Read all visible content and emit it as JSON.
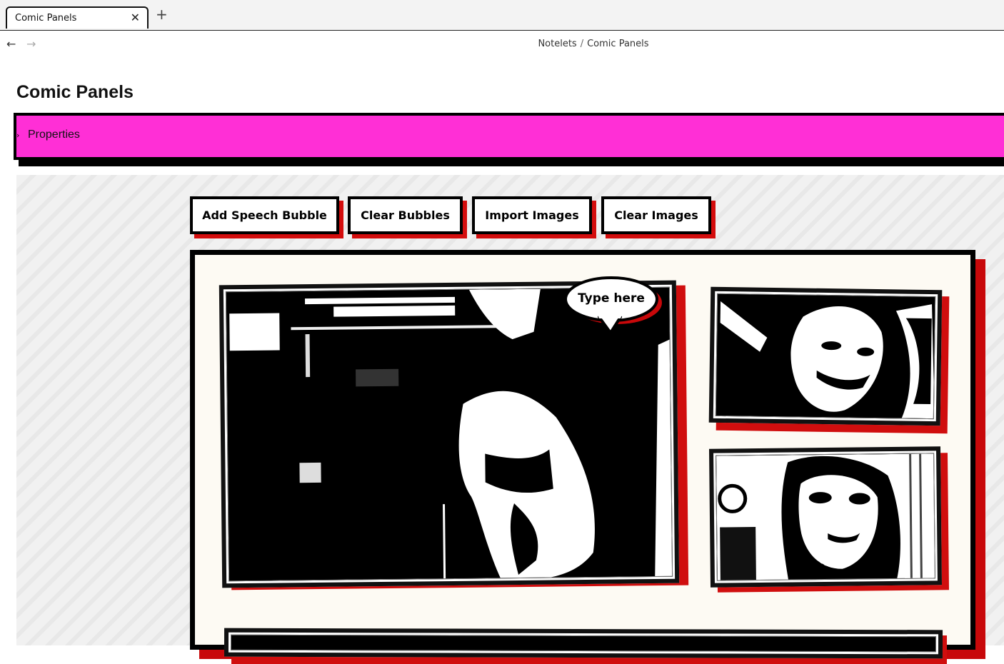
{
  "tab": {
    "title": "Comic Panels",
    "close_icon": "close-icon",
    "new_tab_icon": "plus-icon"
  },
  "nav": {
    "back_icon": "arrow-left-icon",
    "forward_icon": "arrow-right-icon",
    "breadcrumb": {
      "parent": "Notelets",
      "separator": "/",
      "current": "Comic Panels"
    }
  },
  "page": {
    "title": "Comic Panels"
  },
  "properties": {
    "label": "Properties",
    "background_color": "#ff2fd6",
    "chevron_icon": "chevron-right-icon"
  },
  "toolbar": {
    "add_bubble_label": "Add Speech Bubble",
    "clear_bubbles_label": "Clear Bubbles",
    "import_images_label": "Import Images",
    "clear_images_label": "Clear Images",
    "shadow_color": "#d40d0d"
  },
  "comic": {
    "speech_bubble": {
      "text": "Type here"
    },
    "panels": [
      {
        "name": "large-panel",
        "content": "black-and-white photo"
      },
      {
        "name": "top-right-panel",
        "content": "black-and-white photo"
      },
      {
        "name": "middle-right-panel",
        "content": "black-and-white photo"
      },
      {
        "name": "bottom-panel",
        "content": "black-and-white photo"
      }
    ]
  }
}
